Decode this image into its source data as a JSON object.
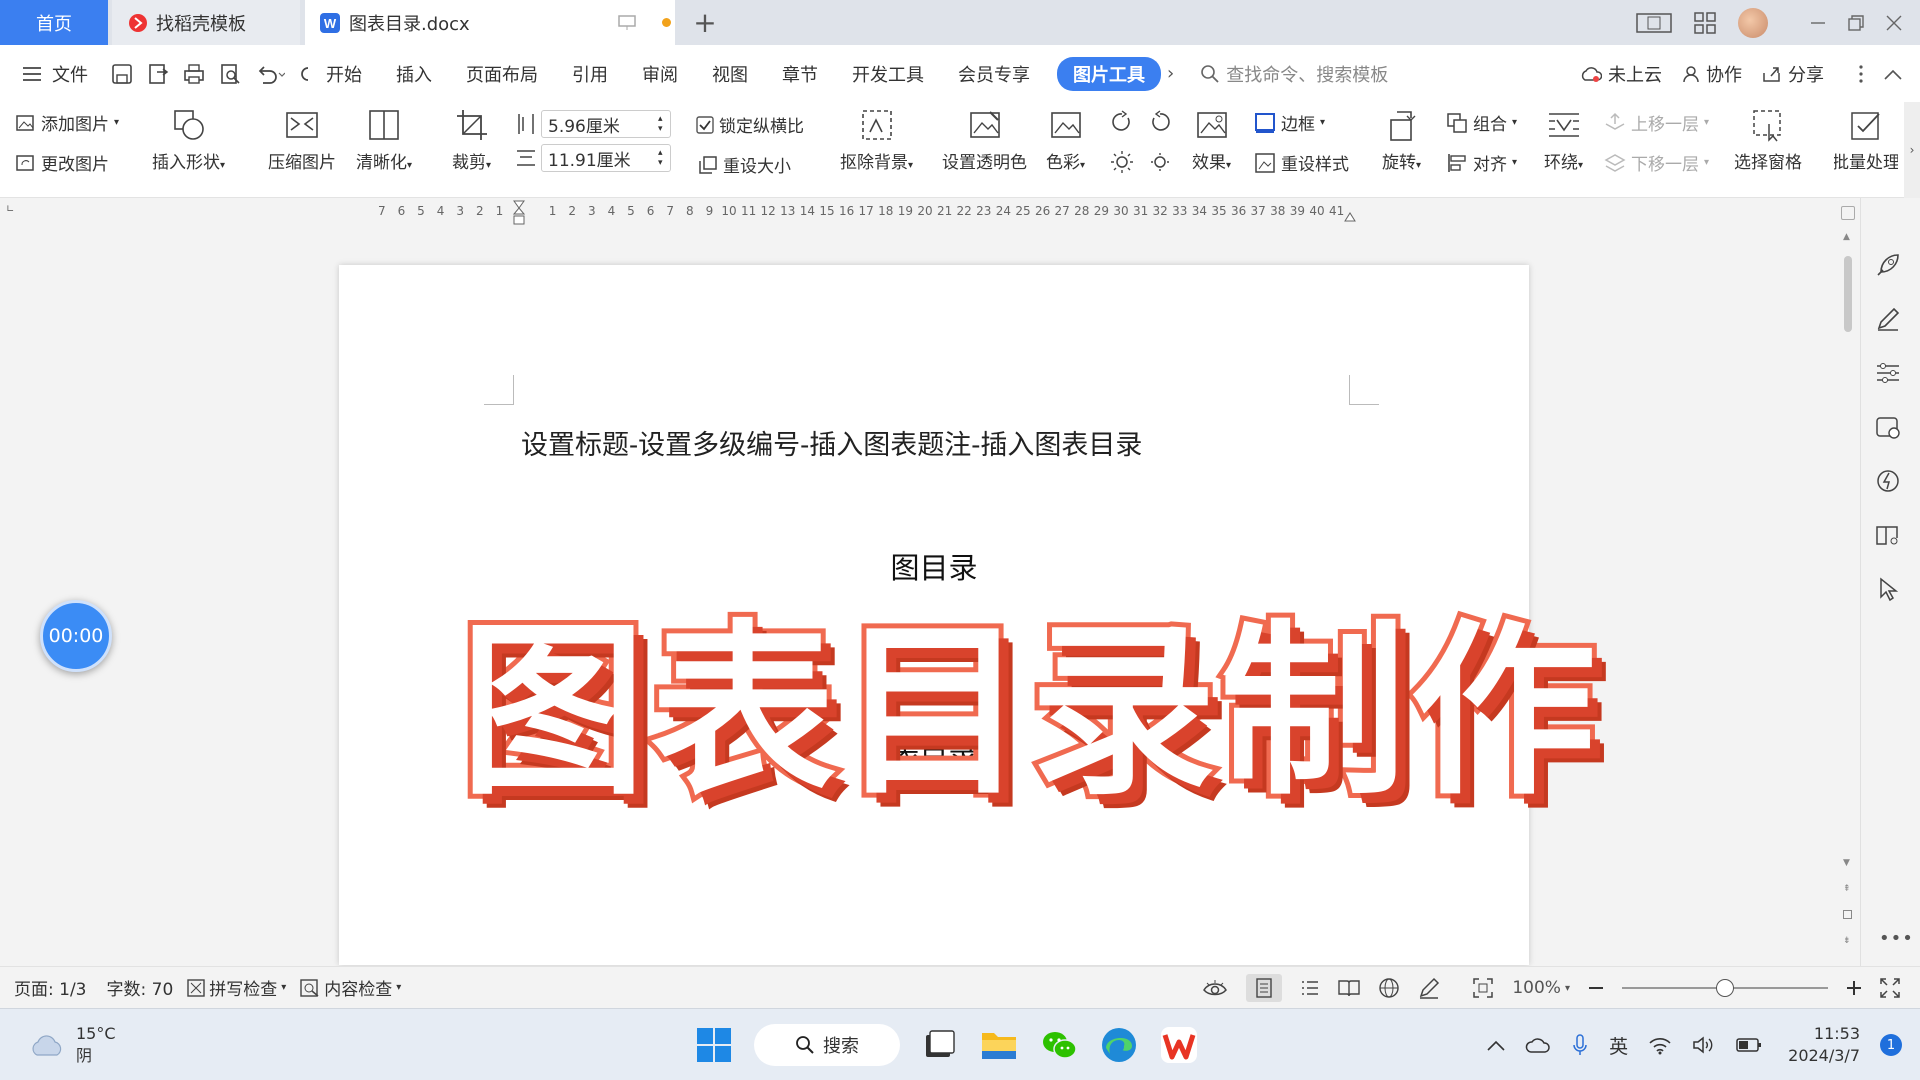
{
  "tabs": {
    "home": "首页",
    "template": "找稻壳模板",
    "document": "图表目录.docx",
    "new_tab": "+"
  },
  "menu": {
    "file": "文件",
    "items": [
      "开始",
      "插入",
      "页面布局",
      "引用",
      "审阅",
      "视图",
      "章节",
      "开发工具",
      "会员专享"
    ],
    "active": "图片工具",
    "search_placeholder": "查找命令、搜索模板",
    "cloud": "未上云",
    "collaborate": "协作",
    "share": "分享"
  },
  "ribbon": {
    "add_picture": "添加图片",
    "change_picture": "更改图片",
    "insert_shape": "插入形状",
    "compress": "压缩图片",
    "sharpen": "清晰化",
    "crop": "裁剪",
    "height": "5.96厘米",
    "width": "11.91厘米",
    "lock_ratio": "锁定纵横比",
    "reset_size": "重设大小",
    "remove_bg": "抠除背景",
    "transparent": "设置透明色",
    "color": "色彩",
    "effects": "效果",
    "border": "边框",
    "reset_style": "重设样式",
    "rotate": "旋转",
    "group": "组合",
    "align": "对齐",
    "wrap": "环绕",
    "bring_forward": "上移一层",
    "send_backward": "下移一层",
    "selection_pane": "选择窗格",
    "batch": "批量处理"
  },
  "ruler": {
    "left": [
      "7",
      "6",
      "5",
      "4",
      "3",
      "2",
      "1"
    ],
    "right": [
      "1",
      "2",
      "3",
      "4",
      "5",
      "6",
      "7",
      "8",
      "9",
      "10",
      "11",
      "12",
      "13",
      "14",
      "15",
      "16",
      "17",
      "18",
      "19",
      "20",
      "21",
      "22",
      "23",
      "24",
      "25",
      "26",
      "27",
      "28",
      "29",
      "30",
      "31",
      "32",
      "33",
      "34",
      "35",
      "36",
      "37",
      "38",
      "39",
      "40",
      "41"
    ]
  },
  "document": {
    "line1": "设置标题-设置多级编号-插入图表题注-插入图表目录",
    "figure_toc": "图目录",
    "table_toc": "表目录",
    "overlay": "图表目录制作"
  },
  "timer": "00:00",
  "status": {
    "page": "页面: 1/3",
    "words": "字数: 70",
    "spell": "拼写检查",
    "content": "内容检查",
    "zoom": "100%"
  },
  "taskbar": {
    "temp": "15°C",
    "weather": "阴",
    "search": "搜索",
    "lang": "英",
    "time": "11:53",
    "date": "2024/3/7",
    "notif": "1"
  },
  "colors": {
    "accent": "#3b7ff0",
    "overlay_fill": "#ffffff",
    "overlay_stroke": "#f06a50"
  }
}
